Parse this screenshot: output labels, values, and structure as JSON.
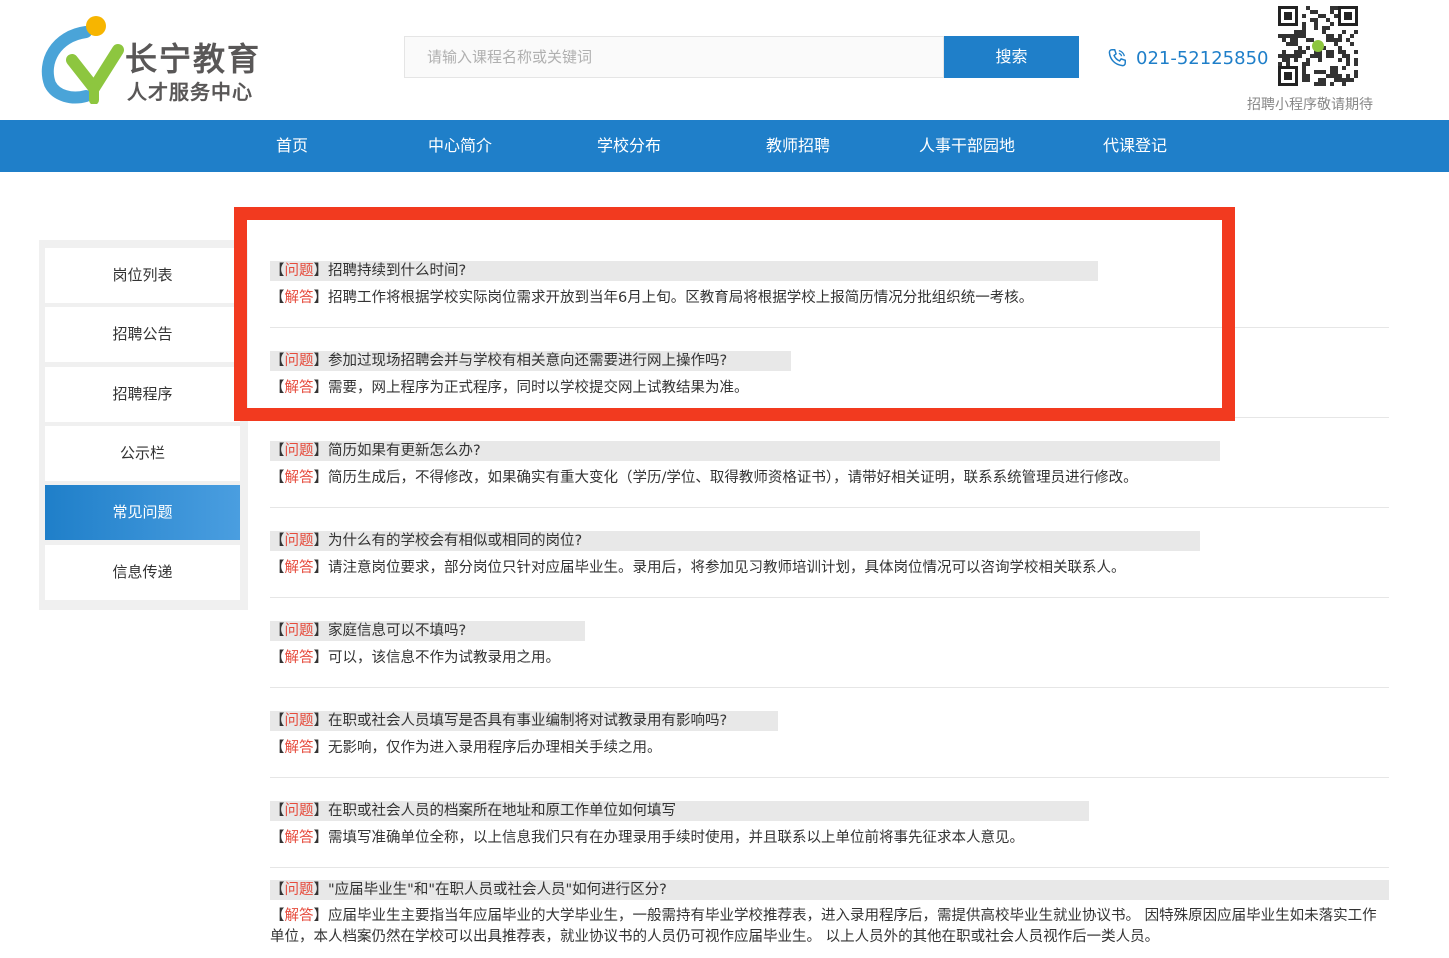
{
  "header": {
    "logo_line1": "长宁教育",
    "logo_line2": "人才服务中心",
    "search_placeholder": "请输入课程名称或关键词",
    "search_button": "搜索",
    "phone": "021-52125850",
    "qr_caption": "招聘小程序敬请期待"
  },
  "nav": {
    "items": [
      "首页",
      "中心简介",
      "学校分布",
      "教师招聘",
      "人事干部园地",
      "代课登记"
    ]
  },
  "sidebar": {
    "items": [
      "岗位列表",
      "招聘公告",
      "招聘程序",
      "公示栏",
      "常见问题",
      "信息传递"
    ],
    "active_index": 4
  },
  "faq": {
    "q_tag": "问题",
    "a_tag": "解答",
    "items": [
      {
        "q": "招聘持续到什么时间?",
        "a": "招聘工作将根据学校实际岗位需求开放到当年6月上旬。区教育局将根据学校上报简历情况分批组织统一考核。"
      },
      {
        "q": "参加过现场招聘会并与学校有相关意向还需要进行网上操作吗?",
        "a": "需要，网上程序为正式程序，同时以学校提交网上试教结果为准。"
      },
      {
        "q": "简历如果有更新怎么办?",
        "a": "简历生成后，不得修改，如果确实有重大变化（学历/学位、取得教师资格证书），请带好相关证明，联系系统管理员进行修改。"
      },
      {
        "q": "为什么有的学校会有相似或相同的岗位?",
        "a": "请注意岗位要求，部分岗位只针对应届毕业生。录用后，将参加见习教师培训计划，具体岗位情况可以咨询学校相关联系人。"
      },
      {
        "q": "家庭信息可以不填吗?",
        "a": "可以，该信息不作为试教录用之用。"
      },
      {
        "q": "在职或社会人员填写是否具有事业编制将对试教录用有影响吗?",
        "a": "无影响，仅作为进入录用程序后办理相关手续之用。"
      },
      {
        "q": "在职或社会人员的档案所在地址和原工作单位如何填写",
        "a": "需填写准确单位全称，以上信息我们只有在办理录用手续时使用，并且联系以上单位前将事先征求本人意见。"
      },
      {
        "q": "\"应届毕业生\"和\"在职人员或社会人员\"如何进行区分?",
        "a": "应届毕业生主要指当年应届毕业的大学毕业生，一般需持有毕业学校推荐表，进入录用程序后，需提供高校毕业生就业协议书。 因特殊原因应届毕业生如未落实工作单位，本人档案仍然在学校可以出具推荐表，就业协议书的人员仍可视作应届毕业生。 以上人员外的其他在职或社会人员视作后一类人员。"
      }
    ]
  },
  "colors": {
    "brand_blue": "#1f7fc9",
    "highlight_red": "#f23a1f",
    "tag_red": "#e64b3c"
  }
}
